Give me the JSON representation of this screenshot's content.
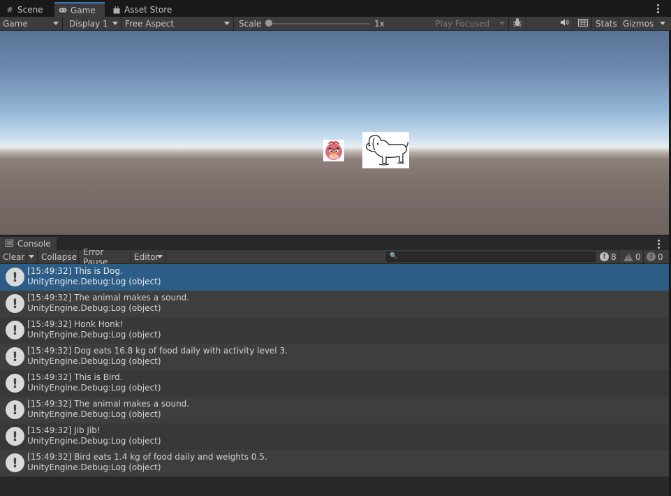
{
  "tabs": [
    {
      "label": "Scene",
      "icon": "hash-icon"
    },
    {
      "label": "Game",
      "icon": "gamepad-icon"
    },
    {
      "label": "Asset Store",
      "icon": "bag-icon"
    }
  ],
  "game_toolbar": {
    "view_select": "Game",
    "display_select": "Display 1",
    "aspect_select": "Free Aspect",
    "scale_label": "Scale",
    "scale_value": "1x",
    "play_mode_select": "Play Focused",
    "stats_label": "Stats",
    "gizmos_label": "Gizmos"
  },
  "console": {
    "tab_label": "Console",
    "clear_label": "Clear",
    "collapse_label": "Collapse",
    "error_pause_label": "Error Pause",
    "editor_label": "Editor",
    "search_placeholder": "",
    "log_count": "8",
    "warning_count": "0",
    "error_count": "0",
    "entries": [
      {
        "message": "[15:49:32] This is Dog.",
        "source": "UnityEngine.Debug:Log (object)"
      },
      {
        "message": "[15:49:32] The animal makes a sound.",
        "source": "UnityEngine.Debug:Log (object)"
      },
      {
        "message": "[15:49:32] Honk Honk!",
        "source": "UnityEngine.Debug:Log (object)"
      },
      {
        "message": "[15:49:32] Dog eats 16.8 kg of food daily with activity level 3.",
        "source": "UnityEngine.Debug:Log (object)"
      },
      {
        "message": "[15:49:32] This is Bird.",
        "source": "UnityEngine.Debug:Log (object)"
      },
      {
        "message": "[15:49:32] The animal makes a sound.",
        "source": "UnityEngine.Debug:Log (object)"
      },
      {
        "message": "[15:49:32] Jib Jib!",
        "source": "UnityEngine.Debug:Log (object)"
      },
      {
        "message": "[15:49:32] Bird eats 1.4 kg of food daily and weights 0.5.",
        "source": "UnityEngine.Debug:Log (object)"
      }
    ]
  },
  "colors": {
    "selection": "#2c5d87",
    "tab_accent": "#3a79bb"
  }
}
